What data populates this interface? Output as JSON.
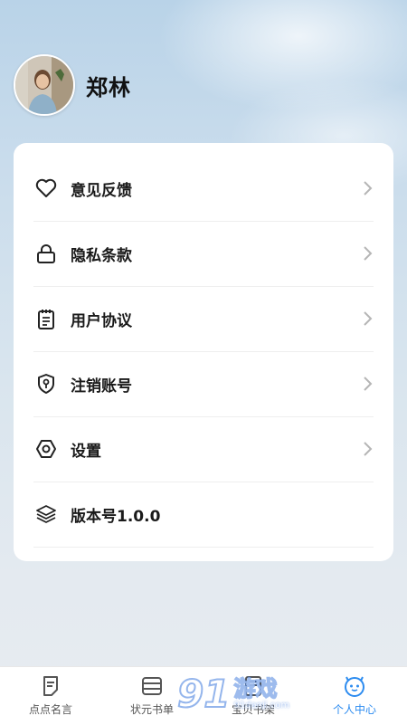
{
  "profile": {
    "name": "郑林",
    "avatar_icon": "user-photo-avatar"
  },
  "menu": [
    {
      "label": "意见反馈",
      "icon": "heart-icon"
    },
    {
      "label": "隐私条款",
      "icon": "lock-icon"
    },
    {
      "label": "用户协议",
      "icon": "notepad-icon"
    },
    {
      "label": "注销账号",
      "icon": "shield-icon"
    },
    {
      "label": "设置",
      "icon": "hexagon-settings-icon"
    },
    {
      "label": "版本号1.0.0",
      "icon": "layers-icon"
    }
  ],
  "tabbar": [
    {
      "label": "点点名言",
      "icon": "note-icon",
      "active": false
    },
    {
      "label": "状元书单",
      "icon": "book-list-icon",
      "active": false
    },
    {
      "label": "宝贝书架",
      "icon": "bookshelf-icon",
      "active": false
    },
    {
      "label": "个人中心",
      "icon": "face-icon",
      "active": true
    }
  ],
  "watermark": {
    "number": "91",
    "text": "游戏",
    "url": "91danji.com"
  },
  "colors": {
    "accent": "#2d8cf0",
    "card": "#ffffff",
    "text": "#1a1a1a"
  }
}
